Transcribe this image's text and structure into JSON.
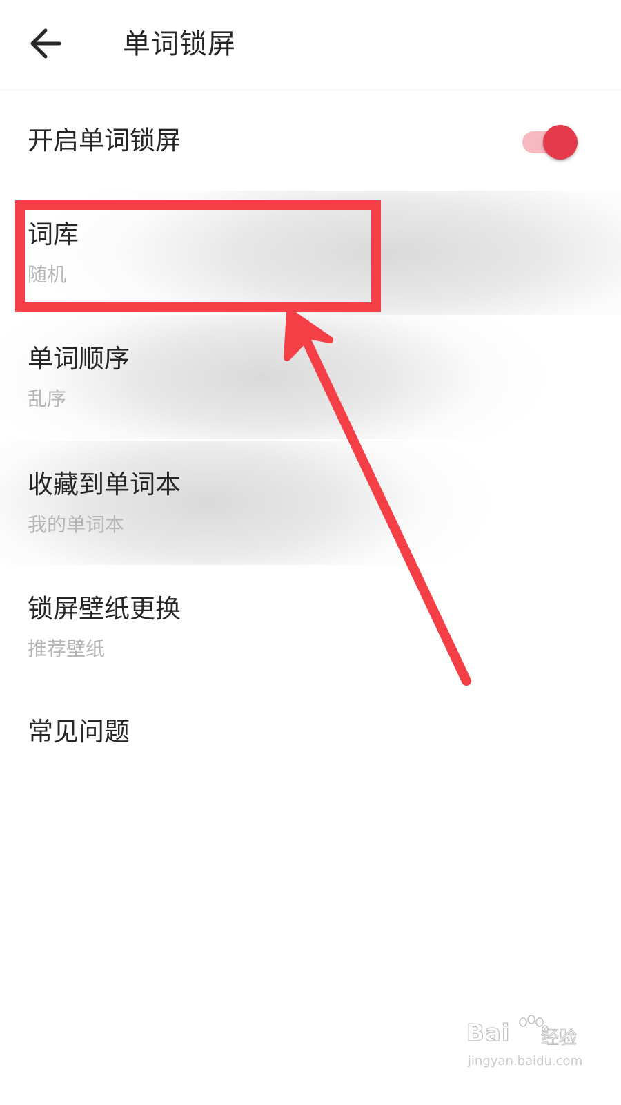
{
  "header": {
    "title": "单词锁屏",
    "back_icon": "arrow-left-icon"
  },
  "lock_toggle": {
    "label": "开启单词锁屏",
    "state": "on",
    "color": "#e43a4c"
  },
  "settings": {
    "library": {
      "title": "词库",
      "value": "随机"
    },
    "order": {
      "title": "单词顺序",
      "value": "乱序"
    },
    "favorites": {
      "title": "收藏到单词本",
      "value": "我的单词本"
    },
    "wallpaper": {
      "title": "锁屏壁纸更换",
      "value": "推荐壁纸"
    },
    "faq": {
      "title": "常见问题"
    }
  },
  "annotation": {
    "highlight_color": "#f43f46",
    "target": "library"
  },
  "watermark": {
    "brand": "Bai",
    "sub": "经验",
    "url": "jingyan.baidu.com"
  }
}
